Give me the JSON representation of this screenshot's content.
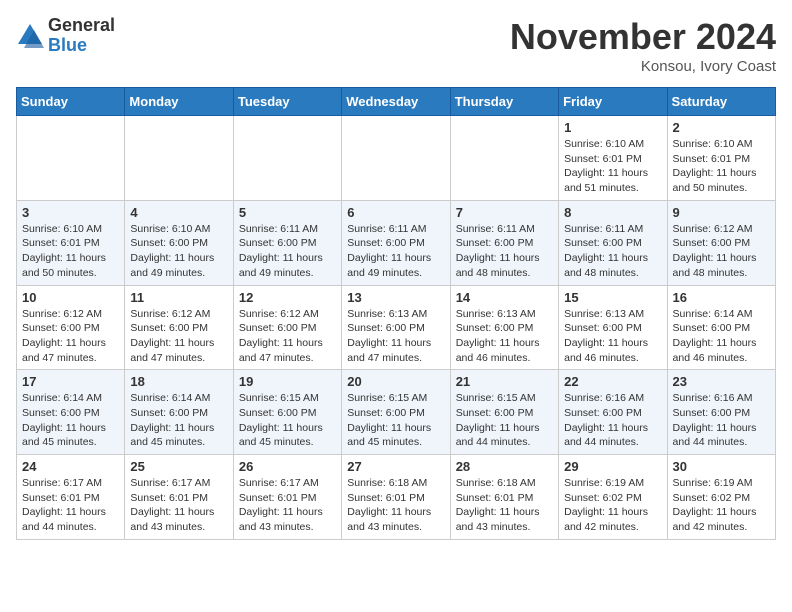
{
  "header": {
    "logo_general": "General",
    "logo_blue": "Blue",
    "month_title": "November 2024",
    "location": "Konsou, Ivory Coast"
  },
  "days_of_week": [
    "Sunday",
    "Monday",
    "Tuesday",
    "Wednesday",
    "Thursday",
    "Friday",
    "Saturday"
  ],
  "weeks": [
    [
      {
        "day": "",
        "info": ""
      },
      {
        "day": "",
        "info": ""
      },
      {
        "day": "",
        "info": ""
      },
      {
        "day": "",
        "info": ""
      },
      {
        "day": "",
        "info": ""
      },
      {
        "day": "1",
        "info": "Sunrise: 6:10 AM\nSunset: 6:01 PM\nDaylight: 11 hours\nand 51 minutes."
      },
      {
        "day": "2",
        "info": "Sunrise: 6:10 AM\nSunset: 6:01 PM\nDaylight: 11 hours\nand 50 minutes."
      }
    ],
    [
      {
        "day": "3",
        "info": "Sunrise: 6:10 AM\nSunset: 6:01 PM\nDaylight: 11 hours\nand 50 minutes."
      },
      {
        "day": "4",
        "info": "Sunrise: 6:10 AM\nSunset: 6:00 PM\nDaylight: 11 hours\nand 49 minutes."
      },
      {
        "day": "5",
        "info": "Sunrise: 6:11 AM\nSunset: 6:00 PM\nDaylight: 11 hours\nand 49 minutes."
      },
      {
        "day": "6",
        "info": "Sunrise: 6:11 AM\nSunset: 6:00 PM\nDaylight: 11 hours\nand 49 minutes."
      },
      {
        "day": "7",
        "info": "Sunrise: 6:11 AM\nSunset: 6:00 PM\nDaylight: 11 hours\nand 48 minutes."
      },
      {
        "day": "8",
        "info": "Sunrise: 6:11 AM\nSunset: 6:00 PM\nDaylight: 11 hours\nand 48 minutes."
      },
      {
        "day": "9",
        "info": "Sunrise: 6:12 AM\nSunset: 6:00 PM\nDaylight: 11 hours\nand 48 minutes."
      }
    ],
    [
      {
        "day": "10",
        "info": "Sunrise: 6:12 AM\nSunset: 6:00 PM\nDaylight: 11 hours\nand 47 minutes."
      },
      {
        "day": "11",
        "info": "Sunrise: 6:12 AM\nSunset: 6:00 PM\nDaylight: 11 hours\nand 47 minutes."
      },
      {
        "day": "12",
        "info": "Sunrise: 6:12 AM\nSunset: 6:00 PM\nDaylight: 11 hours\nand 47 minutes."
      },
      {
        "day": "13",
        "info": "Sunrise: 6:13 AM\nSunset: 6:00 PM\nDaylight: 11 hours\nand 47 minutes."
      },
      {
        "day": "14",
        "info": "Sunrise: 6:13 AM\nSunset: 6:00 PM\nDaylight: 11 hours\nand 46 minutes."
      },
      {
        "day": "15",
        "info": "Sunrise: 6:13 AM\nSunset: 6:00 PM\nDaylight: 11 hours\nand 46 minutes."
      },
      {
        "day": "16",
        "info": "Sunrise: 6:14 AM\nSunset: 6:00 PM\nDaylight: 11 hours\nand 46 minutes."
      }
    ],
    [
      {
        "day": "17",
        "info": "Sunrise: 6:14 AM\nSunset: 6:00 PM\nDaylight: 11 hours\nand 45 minutes."
      },
      {
        "day": "18",
        "info": "Sunrise: 6:14 AM\nSunset: 6:00 PM\nDaylight: 11 hours\nand 45 minutes."
      },
      {
        "day": "19",
        "info": "Sunrise: 6:15 AM\nSunset: 6:00 PM\nDaylight: 11 hours\nand 45 minutes."
      },
      {
        "day": "20",
        "info": "Sunrise: 6:15 AM\nSunset: 6:00 PM\nDaylight: 11 hours\nand 45 minutes."
      },
      {
        "day": "21",
        "info": "Sunrise: 6:15 AM\nSunset: 6:00 PM\nDaylight: 11 hours\nand 44 minutes."
      },
      {
        "day": "22",
        "info": "Sunrise: 6:16 AM\nSunset: 6:00 PM\nDaylight: 11 hours\nand 44 minutes."
      },
      {
        "day": "23",
        "info": "Sunrise: 6:16 AM\nSunset: 6:00 PM\nDaylight: 11 hours\nand 44 minutes."
      }
    ],
    [
      {
        "day": "24",
        "info": "Sunrise: 6:17 AM\nSunset: 6:01 PM\nDaylight: 11 hours\nand 44 minutes."
      },
      {
        "day": "25",
        "info": "Sunrise: 6:17 AM\nSunset: 6:01 PM\nDaylight: 11 hours\nand 43 minutes."
      },
      {
        "day": "26",
        "info": "Sunrise: 6:17 AM\nSunset: 6:01 PM\nDaylight: 11 hours\nand 43 minutes."
      },
      {
        "day": "27",
        "info": "Sunrise: 6:18 AM\nSunset: 6:01 PM\nDaylight: 11 hours\nand 43 minutes."
      },
      {
        "day": "28",
        "info": "Sunrise: 6:18 AM\nSunset: 6:01 PM\nDaylight: 11 hours\nand 43 minutes."
      },
      {
        "day": "29",
        "info": "Sunrise: 6:19 AM\nSunset: 6:02 PM\nDaylight: 11 hours\nand 42 minutes."
      },
      {
        "day": "30",
        "info": "Sunrise: 6:19 AM\nSunset: 6:02 PM\nDaylight: 11 hours\nand 42 minutes."
      }
    ]
  ]
}
